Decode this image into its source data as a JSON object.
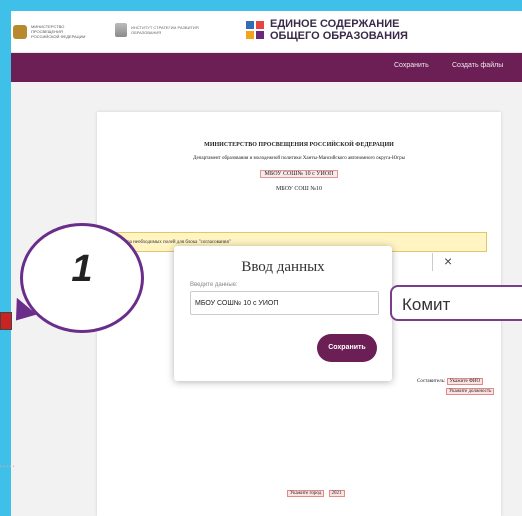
{
  "header": {
    "logo1_text": "МИНИСТЕРСТВО ПРОСВЕЩЕНИЯ РОССИЙСКОЙ ФЕДЕРАЦИИ",
    "logo2_text": "ИНСТИТУТ СТРАТЕГИИ РАЗВИТИЯ ОБРАЗОВАНИЯ",
    "brand_line1": "ЕДИНОЕ СОДЕРЖАНИЕ",
    "brand_line2": "ОБЩЕГО ОБРАЗОВАНИЯ"
  },
  "nav": {
    "save": "Сохранить",
    "create_files": "Создать файлы"
  },
  "document": {
    "ministry": "МИНИСТЕРСТВО ПРОСВЕЩЕНИЯ РОССИЙСКОЙ ФЕДЕРАЦИИ",
    "department": "Департамент образования и молодежной политики Ханты-Мансийского автономного округа-Югры",
    "school_full": "МБОУ СОШ№ 10 с УИОП",
    "school_short": "МБОУ СОШ №10",
    "notice": "Нажмите для выбора необходимых полей для блока \"согласования\"",
    "compiler_label": "Составитель",
    "fio_placeholder": "Укажите ФИО",
    "position_placeholder": "Укажите должность",
    "city_placeholder": "Укажите город",
    "year": "2021"
  },
  "modal": {
    "title": "Ввод данных",
    "input_label": "Введите данные:",
    "input_value": "МБОУ СОШ№ 10 с УИОП",
    "save_button": "Сохранить",
    "close": "×"
  },
  "overlay": {
    "bubble_number": "1",
    "pill_text": "Комит"
  },
  "colors": {
    "accent": "#6b1f55",
    "background": "#3fc0e8"
  }
}
